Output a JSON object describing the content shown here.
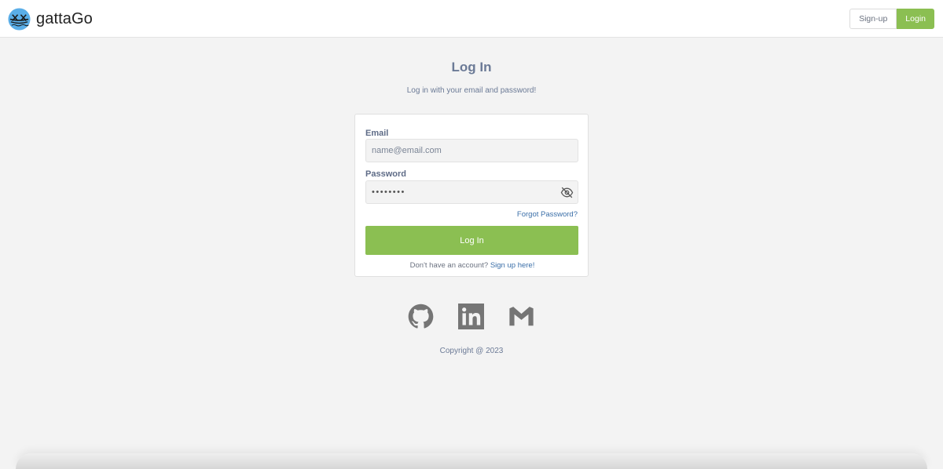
{
  "header": {
    "brand_name": "gattaGo",
    "signup_label": "Sign-up",
    "login_label": "Login",
    "brand_logo_icon": "rowing-boat-logo-icon"
  },
  "login": {
    "title": "Log In",
    "subtitle": "Log in with your email and password!",
    "email_label": "Email",
    "email_placeholder": "name@email.com",
    "password_label": "Password",
    "password_value": "••••••••",
    "password_toggle_icon": "eye-off-icon",
    "forgot_label": "Forgot Password?",
    "submit_label": "Log In",
    "signup_prompt": "Don't have an account? ",
    "signup_link": "Sign up here!"
  },
  "social": {
    "icons": [
      "github-icon",
      "linkedin-icon",
      "gmail-icon"
    ]
  },
  "footer": {
    "copyright": "Copyright @ 2023"
  },
  "colors": {
    "accent": "#8bbf52",
    "link": "#3b6fa8",
    "text_muted": "#6b7a96",
    "background": "#f3f3f3",
    "icon_gray": "#757575"
  }
}
